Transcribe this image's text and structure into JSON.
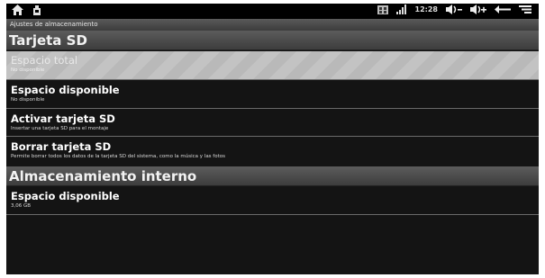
{
  "status_bar": {
    "left_icons": [
      "home-icon",
      "settings-icon"
    ],
    "time": "12:28",
    "right_icons": [
      "screenshot-icon",
      "signal-icon",
      "volume-down-icon",
      "volume-up-icon",
      "back-icon",
      "menu-icon"
    ]
  },
  "window": {
    "title": "Ajustes de almacenamiento"
  },
  "sections": [
    {
      "title": "Tarjeta SD",
      "items": [
        {
          "title": "Espacio total",
          "summary": "No disponible",
          "enabled": false
        },
        {
          "title": "Espacio disponible",
          "summary": "No disponible",
          "enabled": true
        },
        {
          "title": "Activar tarjeta SD",
          "summary": "Insertar una tarjeta SD para el montaje",
          "enabled": true
        },
        {
          "title": "Borrar tarjeta SD",
          "summary": "Permite borrar todos los datos de la tarjeta SD del sistema, como la música y las fotos",
          "enabled": true
        }
      ]
    },
    {
      "title": "Almacenamiento interno",
      "items": [
        {
          "title": "Espacio disponible",
          "summary": "3,06 GB",
          "enabled": true
        }
      ]
    }
  ]
}
